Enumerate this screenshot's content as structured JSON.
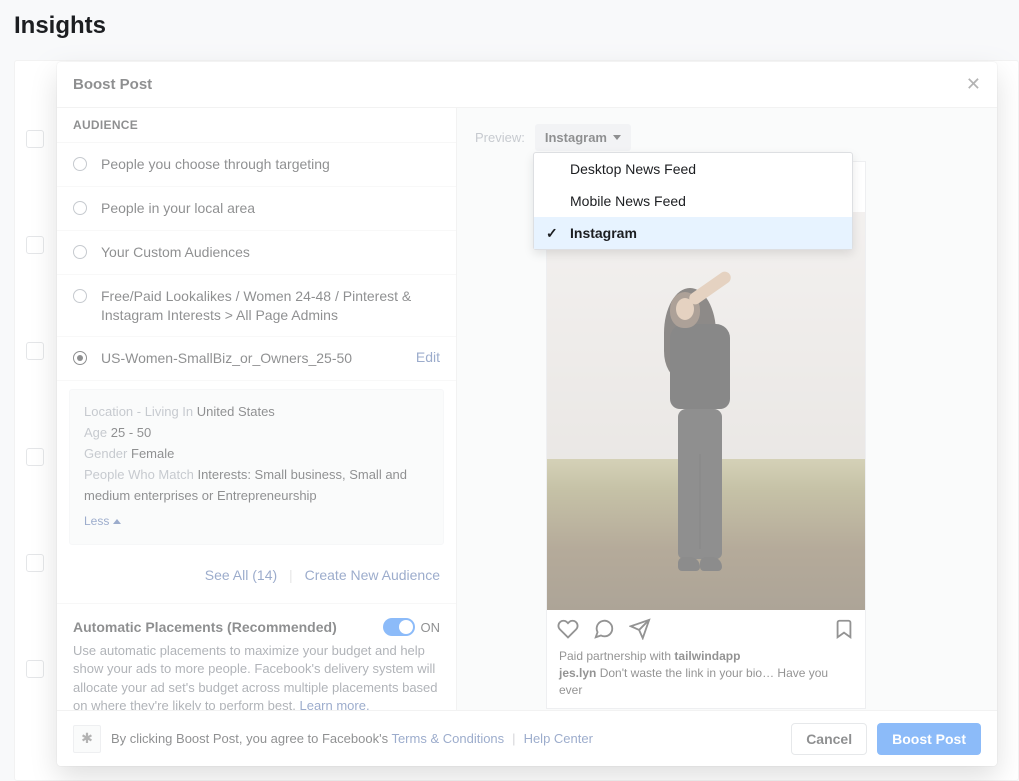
{
  "page": {
    "title": "Insights"
  },
  "modal": {
    "title": "Boost Post",
    "audience_heading": "AUDIENCE",
    "options": [
      {
        "label": "People you choose through targeting"
      },
      {
        "label": "People in your local area"
      },
      {
        "label": "Your Custom Audiences"
      },
      {
        "label": "Free/Paid Lookalikes / Women 24-48 / Pinterest & Instagram Interests > All Page Admins"
      },
      {
        "label": "US-Women-SmallBiz_or_Owners_25-50",
        "selected": true
      }
    ],
    "edit": "Edit",
    "details": {
      "location_label": "Location - Living In",
      "location_val": "United States",
      "age_label": "Age",
      "age_val": "25 - 50",
      "gender_label": "Gender",
      "gender_val": "Female",
      "match_label": "People Who Match",
      "match_val": "Interests: Small business, Small and medium enterprises or Entrepreneurship",
      "less": "Less"
    },
    "see_all": "See All (14)",
    "create_new": "Create New Audience",
    "placements": {
      "title": "Automatic Placements (Recommended)",
      "toggle_state": "ON",
      "desc": "Use automatic placements to maximize your budget and help show your ads to more people. Facebook's delivery system will allocate your ad set's budget across multiple placements based on where they're likely to perform best. ",
      "learn_more": "Learn more."
    }
  },
  "preview": {
    "label": "Preview:",
    "selected": "Instagram",
    "options": [
      "Desktop News Feed",
      "Mobile News Feed",
      "Instagram"
    ],
    "ig": {
      "username": "jes.lyn",
      "location": "",
      "paid_prefix": "Paid partnership with ",
      "paid_partner": "tailwindapp",
      "caption_user": "jes.lyn",
      "caption_text": " Don't waste the link in your bio… Have you ever"
    }
  },
  "footer": {
    "agree_prefix": "By clicking Boost Post, you agree to Facebook's ",
    "terms": "Terms & Conditions",
    "help": "Help Center",
    "cancel": "Cancel",
    "boost": "Boost Post"
  }
}
